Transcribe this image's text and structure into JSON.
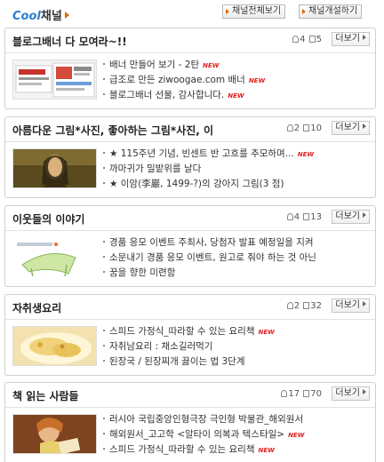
{
  "header": {
    "brand_cool": "Cool",
    "brand_channel": "채널",
    "all_channels_button": "채널전체보기",
    "open_channel_button": "채널개설하기"
  },
  "more_label": "더보기",
  "new_badge": "NEW",
  "channels": [
    {
      "title": "블로그배너 다 모여라~!!",
      "members": "4",
      "posts": "5",
      "thumb": "banner-collage",
      "items": [
        {
          "text": "배너 만들어 보기 - 2탄",
          "new": true
        },
        {
          "text": "급조로 만든 ziwoogae.com 배너",
          "new": true
        },
        {
          "text": "블로그배너 선물, 감사합니다.",
          "new": true
        }
      ]
    },
    {
      "title": "아름다운 그림*사진, 좋아하는 그림*사진, 이",
      "members": "2",
      "posts": "10",
      "thumb": "mona-lisa",
      "items": [
        {
          "text": "★ 115주년 기념, 빈센트 반 고흐를 추모하며...",
          "new": true
        },
        {
          "text": "까마귀가 밀밭위를 날다",
          "new": false
        },
        {
          "text": "★ 이암(李巖, 1499-?)의 강아지 그림(3 점)",
          "new": false
        }
      ]
    },
    {
      "title": "이웃들의 이야기",
      "members": "4",
      "posts": "13",
      "thumb": "green-sketch",
      "items": [
        {
          "text": "경품 응모 이벤트 주최사, 당첨자 발표 예정일을 지켜",
          "new": false
        },
        {
          "text": "소문내기 경품 응모 이벤트, 원고로 줘야 하는 것 아닌",
          "new": false
        },
        {
          "text": "꿈을 향한 미련함",
          "new": false
        }
      ]
    },
    {
      "title": "자취생요리",
      "members": "2",
      "posts": "32",
      "thumb": "food-dish",
      "items": [
        {
          "text": "스피드 가정식_따라할 수 있는 요리책",
          "new": true
        },
        {
          "text": "자취남요리 : 채소길러먹기",
          "new": false
        },
        {
          "text": "된장국 / 된장찌개 끓이는 법 3단계",
          "new": false
        }
      ]
    },
    {
      "title": "책 읽는 사람들",
      "members": "17",
      "posts": "70",
      "thumb": "reading-painting",
      "items": [
        {
          "text": "러시아 국립중앙인형극장 극인형 박물관_해외원서",
          "new": false
        },
        {
          "text": "해외원서_고고학 <알타이 의복과 텍스타일>",
          "new": true
        },
        {
          "text": "스피드 가정식_따라할 수 있는 요리책",
          "new": true
        }
      ]
    }
  ]
}
